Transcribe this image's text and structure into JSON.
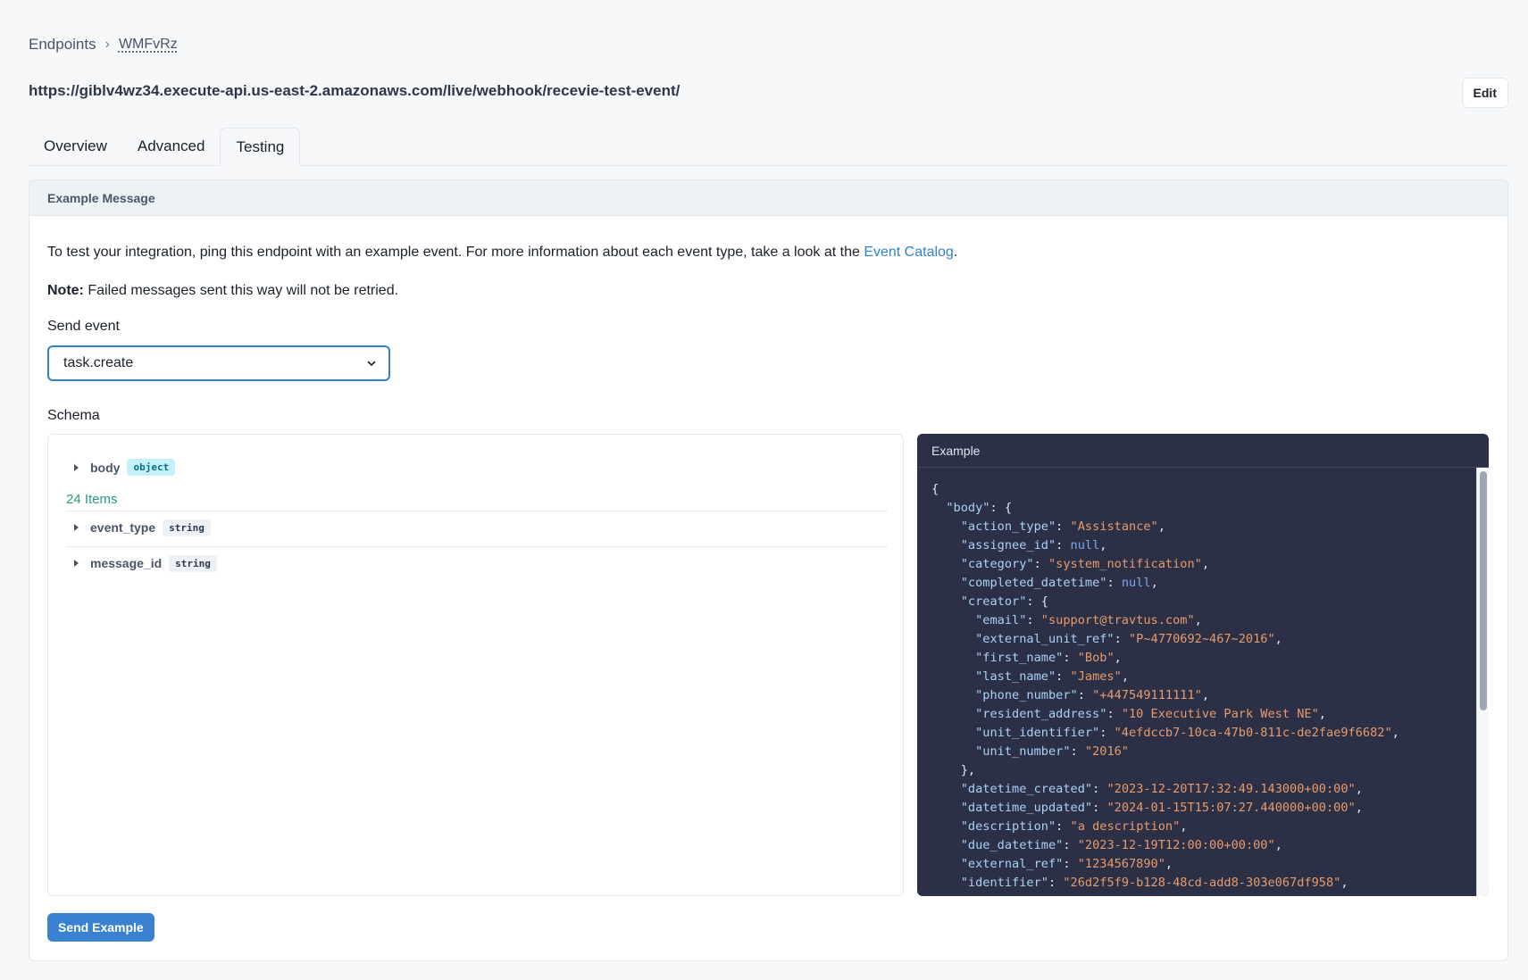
{
  "breadcrumb": {
    "root": "Endpoints",
    "current": "WMFvRz"
  },
  "endpoint_url": "https://giblv4wz34.execute-api.us-east-2.amazonaws.com/live/webhook/recevie-test-event/",
  "edit_label": "Edit",
  "tabs": [
    {
      "label": "Overview"
    },
    {
      "label": "Advanced"
    },
    {
      "label": "Testing",
      "active": true
    }
  ],
  "card": {
    "title": "Example Message",
    "intro_text": "To test your integration, ping this endpoint with an example event. For more information about each event type, take a look at the ",
    "intro_link": "Event Catalog",
    "intro_end": ".",
    "note_label": "Note:",
    "note_text": " Failed messages sent this way will not be retried.",
    "send_event_label": "Send event",
    "selected_event": "task.create",
    "schema_label": "Schema",
    "schema": [
      {
        "name": "body",
        "type": "object"
      },
      {
        "name": "event_type",
        "type": "string"
      },
      {
        "name": "message_id",
        "type": "string"
      }
    ],
    "items_count": "24 Items",
    "example_title": "Example",
    "send_button": "Send Example"
  },
  "example_code": [
    [
      "p",
      "{"
    ],
    [
      "kv",
      "  ",
      "body",
      ": {",
      ""
    ],
    [
      "kvs",
      "    ",
      "action_type",
      "Assistance",
      ","
    ],
    [
      "kvn",
      "    ",
      "assignee_id",
      "null",
      ","
    ],
    [
      "kvs",
      "    ",
      "category",
      "system_notification",
      ","
    ],
    [
      "kvn",
      "    ",
      "completed_datetime",
      "null",
      ","
    ],
    [
      "kv",
      "    ",
      "creator",
      ": {",
      ""
    ],
    [
      "kvs",
      "      ",
      "email",
      "support@travtus.com",
      ","
    ],
    [
      "kvs",
      "      ",
      "external_unit_ref",
      "P~4770692~467~2016",
      ","
    ],
    [
      "kvs",
      "      ",
      "first_name",
      "Bob",
      ","
    ],
    [
      "kvs",
      "      ",
      "last_name",
      "James",
      ","
    ],
    [
      "kvs",
      "      ",
      "phone_number",
      "+447549111111",
      ","
    ],
    [
      "kvs",
      "      ",
      "resident_address",
      "10 Executive Park West NE",
      ","
    ],
    [
      "kvs",
      "      ",
      "unit_identifier",
      "4efdccb7-10ca-47b0-811c-de2fae9f6682",
      ","
    ],
    [
      "kvs",
      "      ",
      "unit_number",
      "2016",
      ""
    ],
    [
      "p",
      "    },"
    ],
    [
      "kvs",
      "    ",
      "datetime_created",
      "2023-12-20T17:32:49.143000+00:00",
      ","
    ],
    [
      "kvs",
      "    ",
      "datetime_updated",
      "2024-01-15T15:07:27.440000+00:00",
      ","
    ],
    [
      "kvs",
      "    ",
      "description",
      "a description",
      ","
    ],
    [
      "kvs",
      "    ",
      "due_datetime",
      "2023-12-19T12:00:00+00:00",
      ","
    ],
    [
      "kvs",
      "    ",
      "external_ref",
      "1234567890",
      ","
    ],
    [
      "kvs",
      "    ",
      "identifier",
      "26d2f5f9-b128-48cd-add8-303e067df958",
      ","
    ]
  ]
}
